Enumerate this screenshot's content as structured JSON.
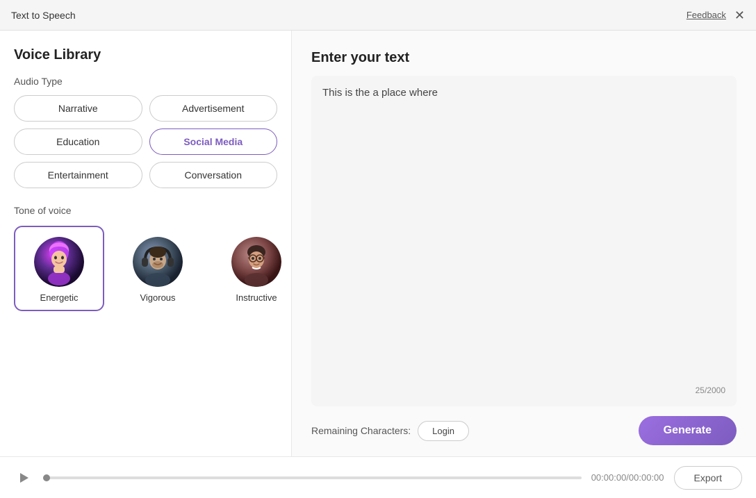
{
  "titleBar": {
    "title": "Text to Speech",
    "feedback": "Feedback",
    "close": "✕"
  },
  "leftPanel": {
    "voiceLibraryTitle": "Voice Library",
    "audioTypeLabel": "Audio Type",
    "audioTypes": [
      {
        "id": "narrative",
        "label": "Narrative",
        "active": false
      },
      {
        "id": "advertisement",
        "label": "Advertisement",
        "active": false
      },
      {
        "id": "education",
        "label": "Education",
        "active": false
      },
      {
        "id": "social-media",
        "label": "Social Media",
        "active": true
      },
      {
        "id": "entertainment",
        "label": "Entertainment",
        "active": false
      },
      {
        "id": "conversation",
        "label": "Conversation",
        "active": false
      }
    ],
    "toneLabel": "Tone of voice",
    "tones": [
      {
        "id": "energetic",
        "label": "Energetic",
        "active": true
      },
      {
        "id": "vigorous",
        "label": "Vigorous",
        "active": false
      },
      {
        "id": "instructive",
        "label": "Instructive",
        "active": false
      }
    ]
  },
  "rightPanel": {
    "enterTextLabel": "Enter your text",
    "textValue": "This is the a place where",
    "charCount": "25/2000"
  },
  "bottomBar": {
    "remainingCharsLabel": "Remaining Characters:",
    "loginLabel": "Login",
    "generateLabel": "Generate"
  },
  "footer": {
    "timeDisplay": "00:00:00/00:00:00",
    "exportLabel": "Export"
  }
}
